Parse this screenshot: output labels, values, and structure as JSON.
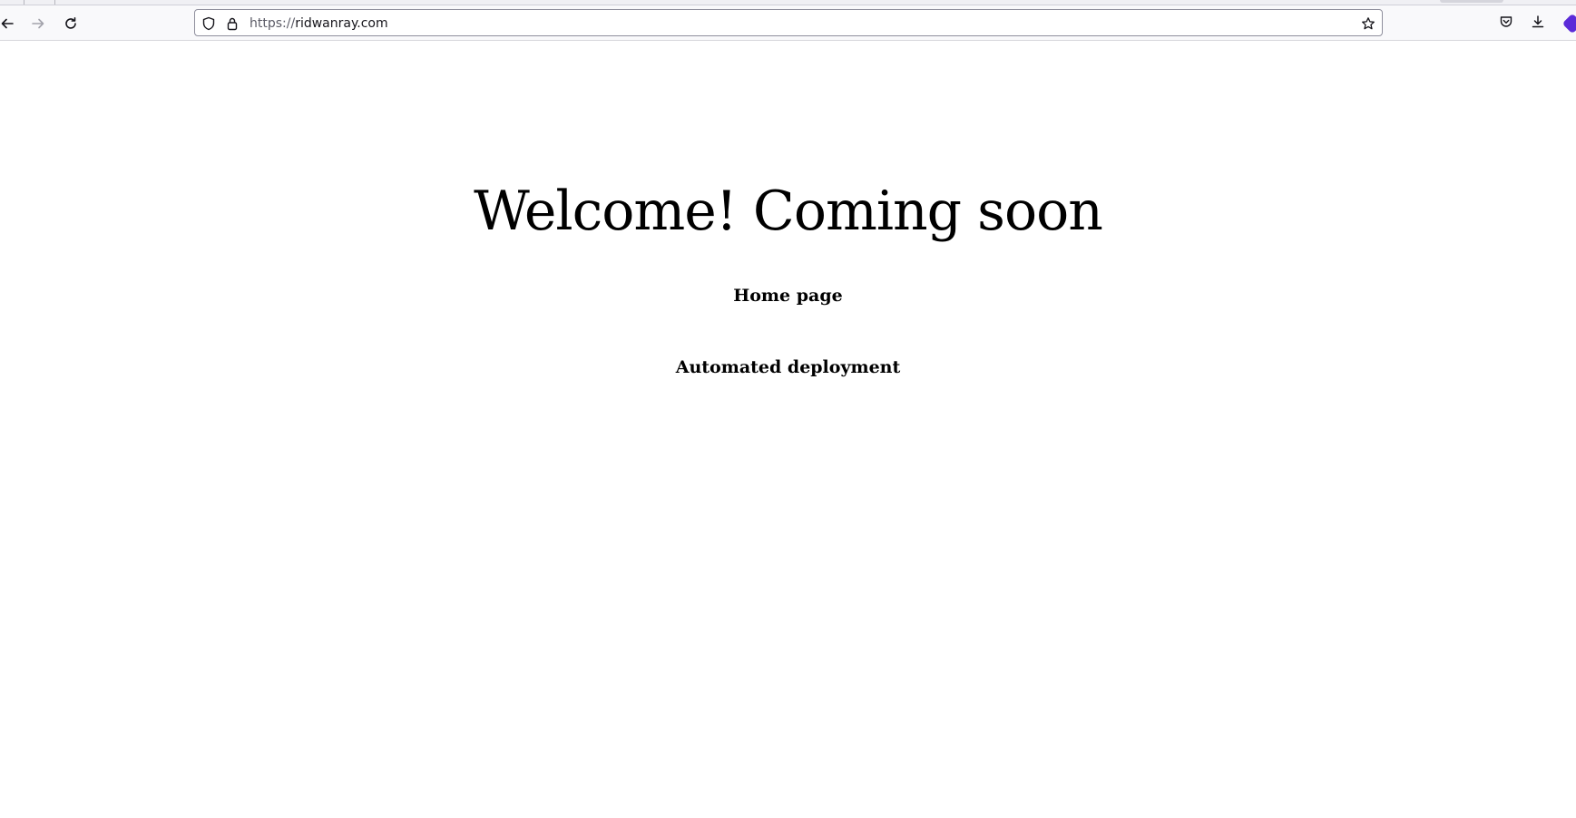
{
  "browser": {
    "url_scheme": "https://",
    "url_host": "ridwanray.com",
    "icons": {
      "back": "arrow-left-icon",
      "forward": "arrow-right-icon",
      "reload": "reload-icon",
      "tracking": "shield-icon",
      "lock": "lock-icon",
      "bookmark": "star-icon",
      "pocket": "pocket-icon",
      "downloads": "download-icon",
      "extension": "extension-icon"
    }
  },
  "page": {
    "title": "Welcome! Coming soon",
    "subtitle_1": "Home page",
    "subtitle_2": "Automated deployment"
  }
}
